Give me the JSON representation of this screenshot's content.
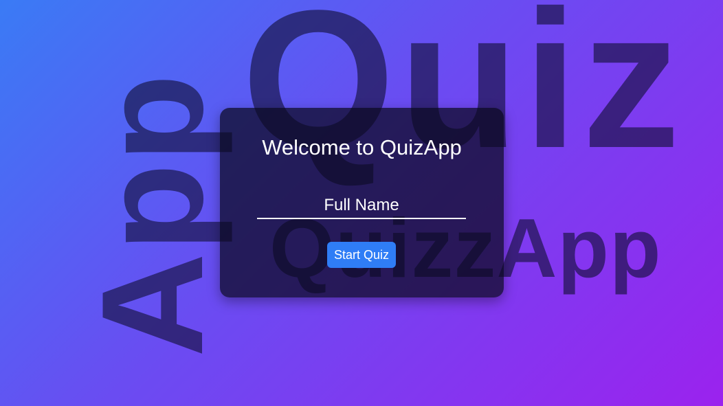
{
  "background": {
    "words": {
      "quiz": "Quiz",
      "app": "App",
      "quizzapp": "QuizzApp"
    }
  },
  "card": {
    "title": "Welcome to QuizApp",
    "name_field": {
      "placeholder": "Full Name",
      "value": ""
    },
    "start_button_label": "Start Quiz"
  },
  "colors": {
    "gradient_start": "#3a7bf5",
    "gradient_end": "#9b22ee",
    "button": "#2f7df6",
    "card": "rgba(10,8,30,0.72)"
  }
}
